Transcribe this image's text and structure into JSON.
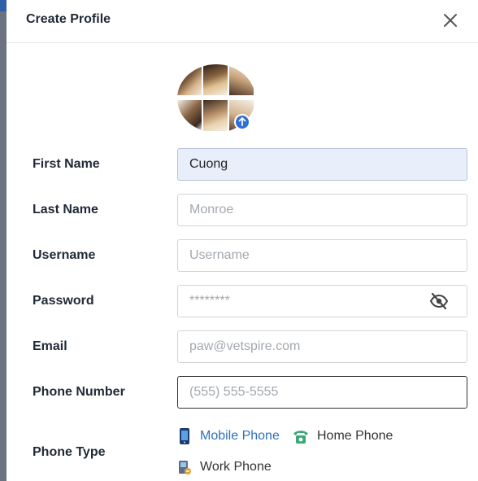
{
  "dialog": {
    "title": "Create Profile"
  },
  "form": {
    "first_name": {
      "label": "First Name",
      "value": "Cuong",
      "placeholder": ""
    },
    "last_name": {
      "label": "Last Name",
      "placeholder": "Monroe"
    },
    "username": {
      "label": "Username",
      "placeholder": "Username"
    },
    "password": {
      "label": "Password",
      "placeholder": "********"
    },
    "email": {
      "label": "Email",
      "placeholder": "paw@vetspire.com"
    },
    "phone_number": {
      "label": "Phone Number",
      "placeholder": "(555) 555-5555"
    },
    "phone_type": {
      "label": "Phone Type",
      "options": [
        "Mobile Phone",
        "Home Phone",
        "Work Phone"
      ],
      "selected": "Mobile Phone"
    }
  },
  "colors": {
    "accent": "#2f6fbf",
    "upload_badge": "#2f6fd6",
    "filled_field_bg": "#e8effb"
  },
  "icons": {
    "close": "close-icon",
    "visibility": "eye-off-icon",
    "upload": "upload-icon"
  }
}
